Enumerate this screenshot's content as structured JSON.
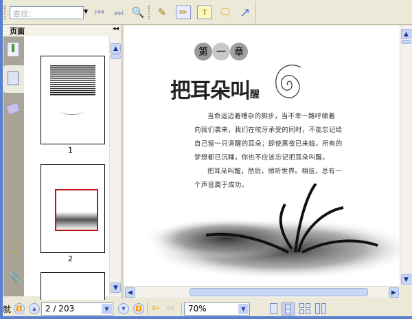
{
  "toolbar": {
    "search_placeholder": "查找："
  },
  "sidebar": {
    "title": "页面",
    "collapse": "◂◂",
    "thumbnails": [
      {
        "label": "1"
      },
      {
        "label": "2"
      }
    ]
  },
  "document": {
    "chapter": [
      "第",
      "一",
      "章"
    ],
    "title": "把耳朵叫",
    "title_small": "醒",
    "paragraphs": [
      "当命运迈着嘈杂的脚步，当不幸一路呼啸着",
      "向我们袭来，我们在咬牙承受的同时，不能忘记给",
      "自己留一只清醒的耳朵；即使黑夜已来临，所有的",
      "梦想都已沉睡，你也不应该忘记把耳朵叫醒。",
      "把耳朵叫醒，然后，倾听世界。相信，总有一",
      "个声音属于成功。"
    ]
  },
  "statusbar": {
    "status": "就",
    "page": "2 / 203",
    "zoom": "70%"
  },
  "colors": {
    "accent": "#5a7fd0",
    "thumb_highlight": "#c0141c"
  }
}
